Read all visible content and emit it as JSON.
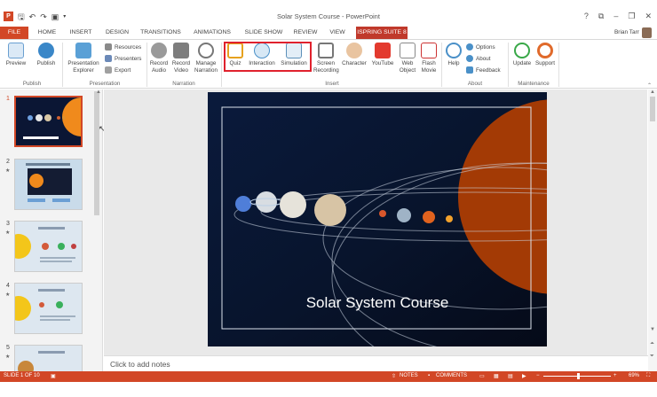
{
  "window": {
    "title": "Solar System Course - PowerPoint",
    "controls": [
      "?",
      "⧉",
      "–",
      "❐",
      "✕"
    ]
  },
  "qat": {
    "logo": "P"
  },
  "tabs": [
    {
      "label": "FILE"
    },
    {
      "label": "HOME"
    },
    {
      "label": "INSERT"
    },
    {
      "label": "DESIGN"
    },
    {
      "label": "TRANSITIONS"
    },
    {
      "label": "ANIMATIONS"
    },
    {
      "label": "SLIDE SHOW"
    },
    {
      "label": "REVIEW"
    },
    {
      "label": "VIEW"
    },
    {
      "label": "ISPRING SUITE 8"
    }
  ],
  "user": {
    "name": "Brian Tarr"
  },
  "ribbon": {
    "publish": {
      "preview": "Preview",
      "publish": "Publish",
      "group": "Publish"
    },
    "presentation": {
      "explorer": "Presentation\nExplorer",
      "resources": "Resources",
      "presenters": "Presenters",
      "export": "Export",
      "group": "Presentation"
    },
    "narration": {
      "record_audio": "Record\nAudio",
      "record_video": "Record\nVideo",
      "manage": "Manage\nNarration",
      "group": "Narration"
    },
    "insert": {
      "quiz": "Quiz",
      "interaction": "Interaction",
      "simulation": "Simulation",
      "screen": "Screen\nRecording",
      "character": "Character",
      "youtube": "YouTube",
      "web": "Web\nObject",
      "flash": "Flash\nMovie",
      "group": "Insert"
    },
    "about": {
      "help": "Help",
      "options": "Options",
      "about": "About",
      "feedback": "Feedback",
      "group": "About"
    },
    "maintenance": {
      "update": "Update",
      "support": "Support",
      "group": "Maintenance"
    }
  },
  "thumbnails": [
    {
      "num": "1"
    },
    {
      "num": "2"
    },
    {
      "num": "3"
    },
    {
      "num": "4"
    },
    {
      "num": "5"
    }
  ],
  "slide": {
    "title": "Solar System Course"
  },
  "notes": {
    "placeholder": "Click to add notes"
  },
  "status": {
    "slide_info": "SLIDE 1 OF 10",
    "notes": "NOTES",
    "comments": "COMMENTS",
    "zoom": "69%"
  },
  "colors": {
    "accent": "#d24726",
    "ispring": "#c0392b",
    "highlight": "#e0212d"
  }
}
